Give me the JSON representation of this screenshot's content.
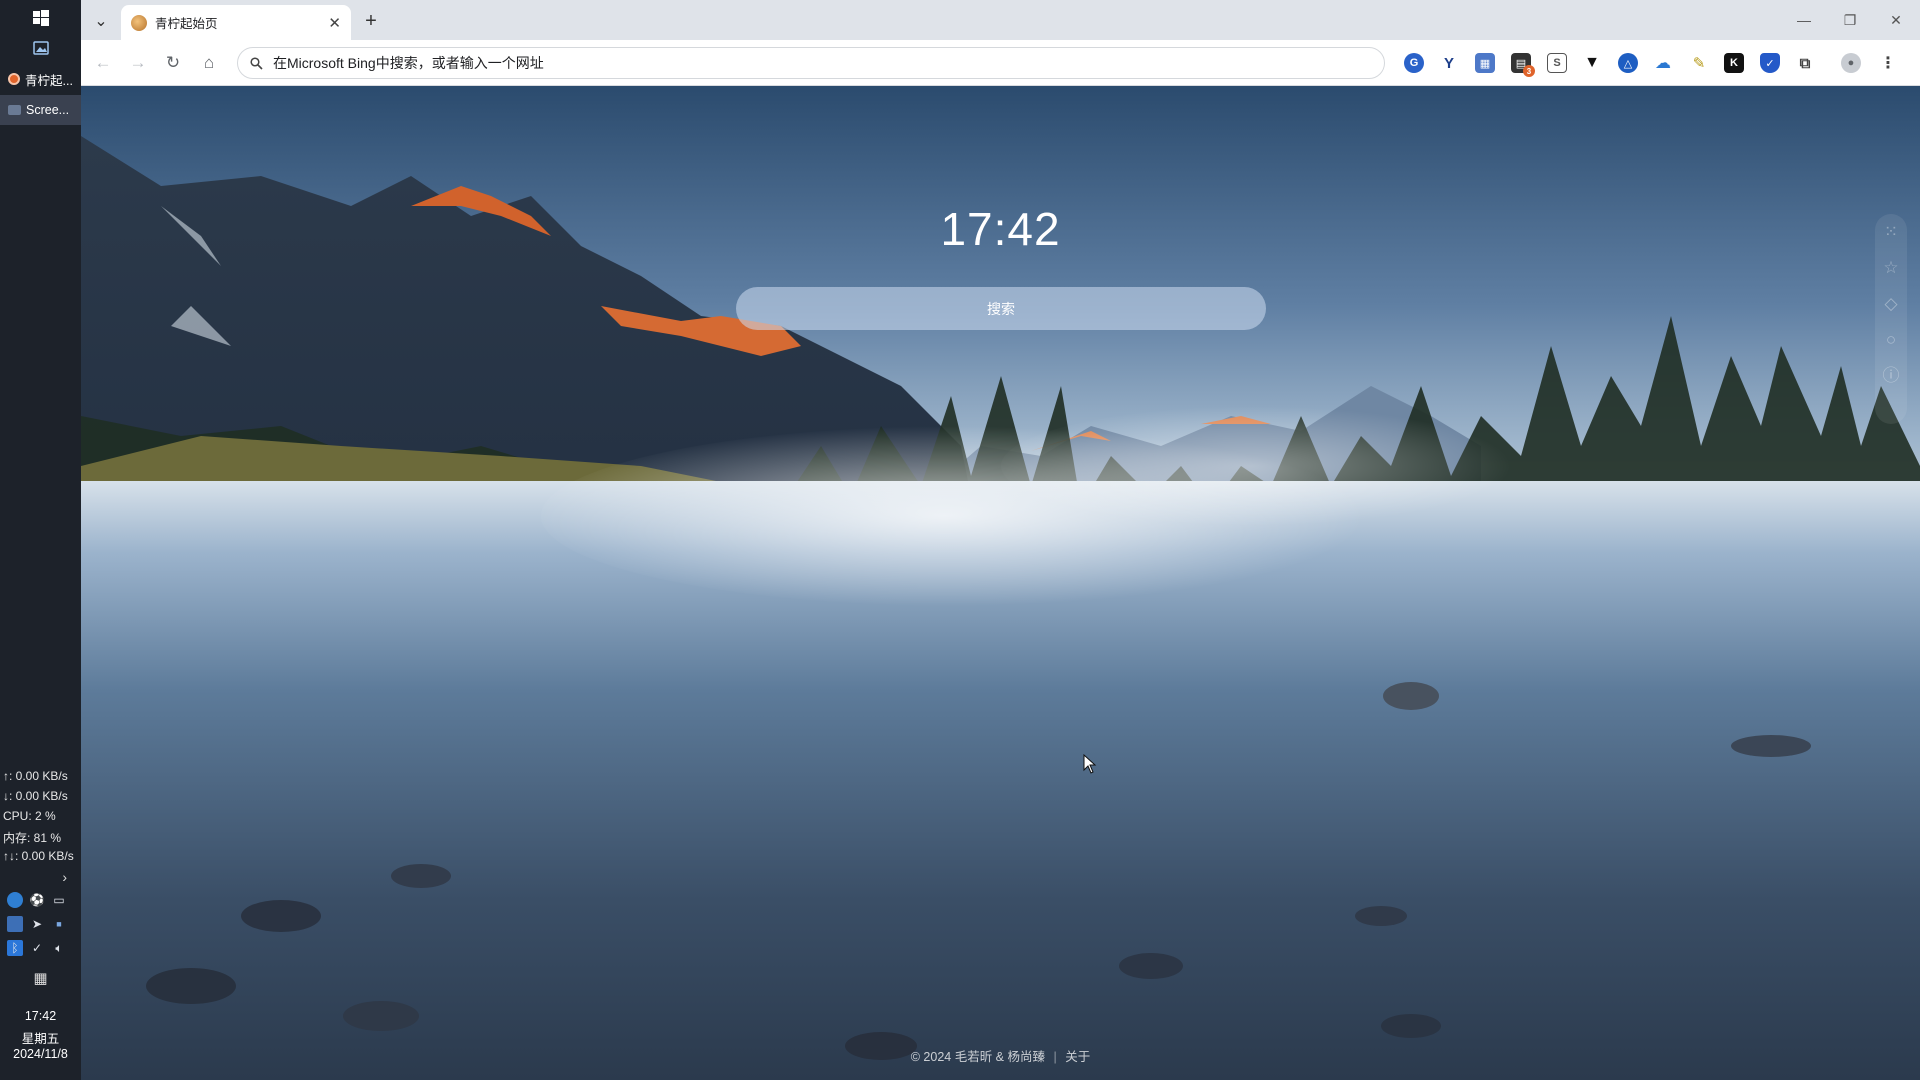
{
  "taskbar": {
    "apps": [
      {
        "label": "青柠起...",
        "icon": "qingning-icon"
      },
      {
        "label": "Scree...",
        "icon": "screenshot-icon"
      }
    ],
    "stats": {
      "upload": "↑: 0.00 KB/s",
      "download": "↓: 0.00 KB/s",
      "cpu": "CPU: 2 %",
      "memory": "内存: 81 %",
      "total": "↑↓: 0.00 KB/s"
    },
    "clock": {
      "time": "17:42",
      "weekday": "星期五",
      "date": "2024/11/8"
    }
  },
  "browser": {
    "tab": {
      "title": "青柠起始页"
    },
    "omnibox": {
      "text": "在Microsoft Bing中搜索，或者输入一个网址"
    },
    "extension_badge": "3"
  },
  "page": {
    "time": "17:42",
    "search_placeholder": "搜索",
    "footer": {
      "copyright": "© 2024 毛若昕 & 杨尚臻",
      "about": "关于"
    }
  },
  "colors": {
    "accent": "#e0642b",
    "toolbar": "#ffffff",
    "tabstrip": "#dfe3e9",
    "taskbar": "#1d222a"
  }
}
